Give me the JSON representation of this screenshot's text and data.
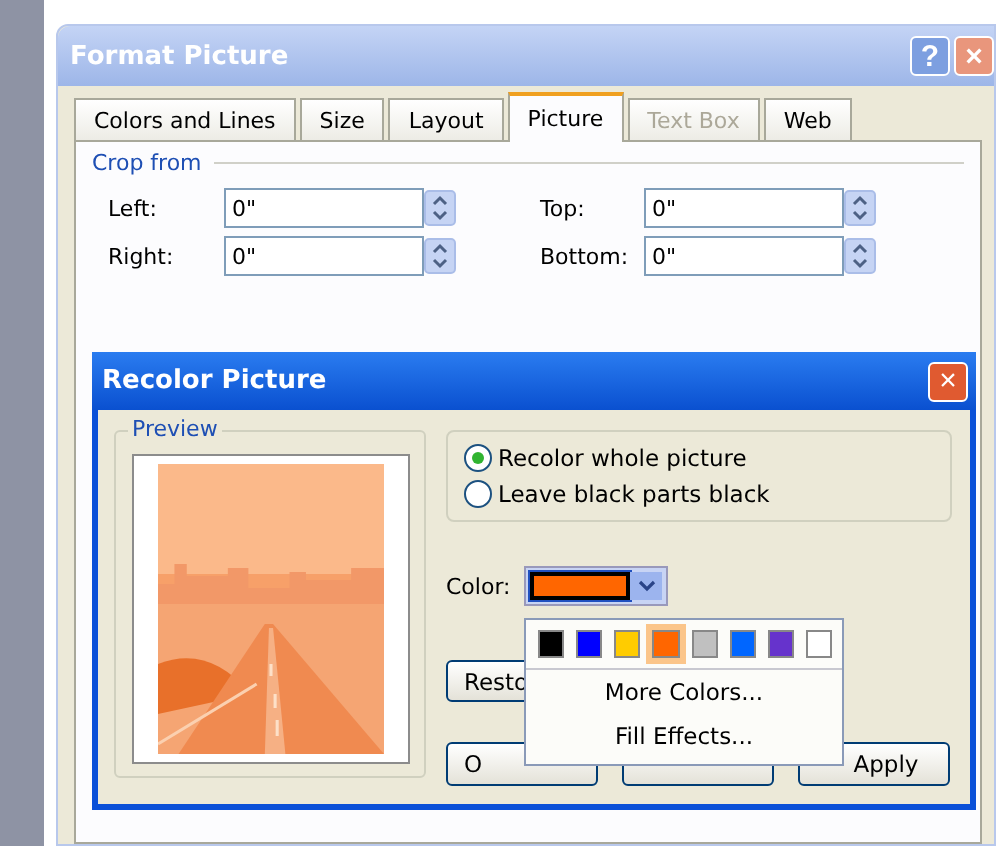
{
  "window": {
    "title": "Format Picture",
    "help": "?",
    "close": "×"
  },
  "tabs": [
    {
      "label": "Colors and Lines",
      "selected": false,
      "disabled": false
    },
    {
      "label": "Size",
      "selected": false,
      "disabled": false
    },
    {
      "label": "Layout",
      "selected": false,
      "disabled": false
    },
    {
      "label": "Picture",
      "selected": true,
      "disabled": false
    },
    {
      "label": "Text Box",
      "selected": false,
      "disabled": true
    },
    {
      "label": "Web",
      "selected": false,
      "disabled": false
    }
  ],
  "crop": {
    "title": "Crop from",
    "fields": [
      {
        "label": "Left:",
        "value": "0\""
      },
      {
        "label": "Top:",
        "value": "0\""
      },
      {
        "label": "Right:",
        "value": "0\""
      },
      {
        "label": "Bottom:",
        "value": "0\""
      }
    ]
  },
  "recolor": {
    "title": "Recolor Picture",
    "close": "×",
    "preview": {
      "title": "Preview",
      "kind": "picture"
    },
    "options": [
      {
        "label": "Recolor whole picture",
        "selected": true
      },
      {
        "label": "Leave black parts black",
        "selected": false
      }
    ],
    "color_label": "Color:",
    "color": "#ff6600",
    "swatches": [
      {
        "color": "#000000",
        "selected": false
      },
      {
        "color": "#0000ff",
        "selected": false
      },
      {
        "color": "#ffcc00",
        "selected": false
      },
      {
        "color": "#ff6600",
        "selected": true
      },
      {
        "color": "#c0c0c0",
        "selected": false
      },
      {
        "color": "#0066ff",
        "selected": false
      },
      {
        "color": "#6633cc",
        "selected": false
      },
      {
        "color": "#ffffff",
        "selected": false
      }
    ],
    "menu": [
      "More Colors...",
      "Fill Effects..."
    ],
    "restore": "Resto",
    "buttons": [
      "O",
      "Apply"
    ]
  }
}
